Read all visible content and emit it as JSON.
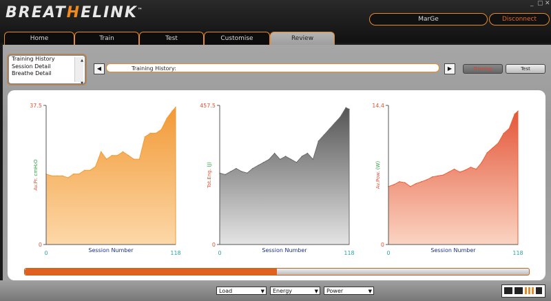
{
  "app": {
    "logo_pre": "BREAT",
    "logo_hl": "H",
    "logo_mid": "E",
    "logo_post": "LINK",
    "logo_tm": "™"
  },
  "header": {
    "user": "MarGe",
    "disconnect": "Disconnect"
  },
  "tabs": [
    {
      "label": "Home"
    },
    {
      "label": "Train"
    },
    {
      "label": "Test"
    },
    {
      "label": "Customise"
    },
    {
      "label": "Review",
      "active": true
    }
  ],
  "review_list": [
    "Training History",
    "Session Detail",
    "Breathe Detail"
  ],
  "path": {
    "text": "Training History:"
  },
  "mode_buttons": {
    "training": "Training",
    "test": "Test"
  },
  "progress": {
    "value_pct": 0.5
  },
  "selects": {
    "load": "Load",
    "energy": "Energy",
    "power": "Power"
  },
  "colors": {
    "accent": "#e68a2e",
    "load": "#f29a36",
    "energy": "#6b6b6b",
    "power": "#e8613a"
  },
  "chart_data": [
    {
      "type": "area",
      "ylabel_prefix": "Av.Pr.",
      "ylabel_unit": "cmH₂O",
      "xlabel": "Session Number",
      "y_top_label": "37.5",
      "y_bottom_label": "0",
      "x_left_label": "0",
      "x_right_label": "118",
      "ylim": [
        0,
        37.5
      ],
      "xlim": [
        0,
        118
      ],
      "x": [
        0,
        5,
        10,
        15,
        20,
        25,
        30,
        35,
        40,
        45,
        50,
        55,
        60,
        65,
        70,
        75,
        80,
        85,
        90,
        95,
        100,
        105,
        110,
        115,
        118
      ],
      "y": [
        19,
        18.5,
        18.5,
        18.5,
        18,
        19,
        19,
        20,
        20,
        21,
        25,
        23,
        24,
        24,
        25,
        24,
        23,
        23,
        29,
        30,
        30,
        31,
        34,
        36,
        37
      ]
    },
    {
      "type": "area",
      "ylabel_prefix": "Tot.Eng.",
      "ylabel_unit": "(J)",
      "xlabel": "Session Number",
      "y_top_label": "457.5",
      "y_bottom_label": "0",
      "x_left_label": "0",
      "x_right_label": "118",
      "ylim": [
        0,
        457.5
      ],
      "xlim": [
        0,
        118
      ],
      "x": [
        0,
        5,
        10,
        15,
        20,
        25,
        30,
        35,
        40,
        45,
        50,
        55,
        60,
        65,
        70,
        75,
        80,
        85,
        90,
        95,
        100,
        105,
        110,
        115,
        118
      ],
      "y": [
        235,
        230,
        240,
        250,
        240,
        235,
        250,
        260,
        270,
        280,
        300,
        280,
        290,
        280,
        270,
        290,
        300,
        280,
        340,
        360,
        380,
        400,
        420,
        450,
        445
      ]
    },
    {
      "type": "area",
      "ylabel_prefix": "Av.Pow.",
      "ylabel_unit": "(W)",
      "xlabel": "Session Number",
      "y_top_label": "14.4",
      "y_bottom_label": "0",
      "x_left_label": "0",
      "x_right_label": "118",
      "ylim": [
        0,
        14.4
      ],
      "xlim": [
        0,
        118
      ],
      "x": [
        0,
        5,
        10,
        15,
        20,
        25,
        30,
        35,
        40,
        45,
        50,
        55,
        60,
        65,
        70,
        75,
        80,
        85,
        90,
        95,
        100,
        105,
        110,
        115,
        118
      ],
      "y": [
        6,
        6.2,
        6.5,
        6.4,
        6,
        6.3,
        6.5,
        6.7,
        7,
        7.1,
        7.2,
        7.5,
        7.8,
        7.5,
        7.7,
        8,
        7.8,
        8.5,
        9.5,
        10,
        10.5,
        11.5,
        12,
        13.5,
        13.8
      ]
    }
  ]
}
